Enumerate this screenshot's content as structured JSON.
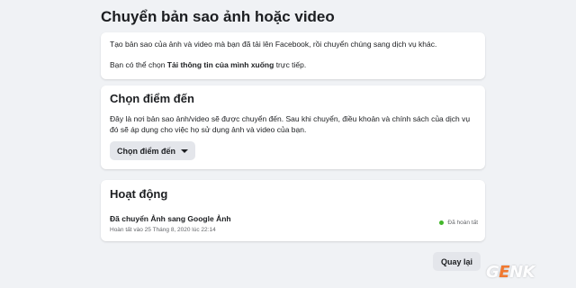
{
  "page": {
    "title": "Chuyển bản sao ảnh hoặc video"
  },
  "intro": {
    "line1": "Tạo bản sao của ảnh và video mà bạn đã tải lên Facebook, rồi chuyển chúng sang dịch vụ khác.",
    "line2_prefix": "Bạn có thể chọn ",
    "line2_bold": "Tải thông tin của mình xuống",
    "line2_suffix": " trực tiếp."
  },
  "destination": {
    "heading": "Chọn điểm đến",
    "description": "Đây là nơi bản sao ảnh/video sẽ được chuyển đến. Sau khi chuyển, điều khoản và chính sách của dịch vụ đó sẽ áp dụng cho việc họ sử dụng ảnh và video của bạn.",
    "button_label": "Chọn điểm đến",
    "button_icon": "caret-down-icon"
  },
  "activity": {
    "heading": "Hoạt động",
    "item_title": "Đã chuyển Ảnh sang Google Ảnh",
    "item_time": "Hoàn tất vào 25 Tháng 8, 2020 lúc 22:14",
    "status_label": "Đã hoàn tất",
    "status_color": "#42b72a"
  },
  "footer": {
    "back_label": "Quay lại"
  },
  "watermark": {
    "part1": "G",
    "accent": "E",
    "part2": "NK"
  },
  "colors": {
    "background": "#f0f2f5",
    "card": "#ffffff",
    "button": "#e4e6eb",
    "watermark_accent": "#f26f21"
  }
}
